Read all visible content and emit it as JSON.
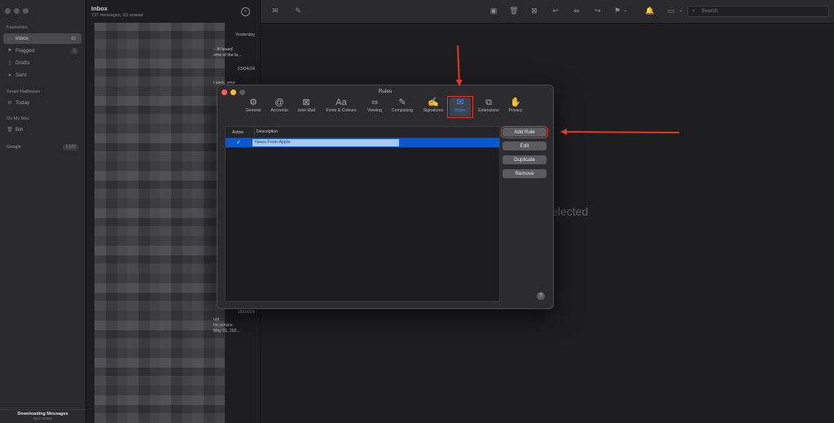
{
  "sidebar": {
    "favourites_heading": "Favourites",
    "items": [
      {
        "icon": "inbox-icon",
        "label": "Inbox",
        "badge": "63"
      },
      {
        "icon": "flag-icon",
        "label": "Flagged",
        "badge": "1"
      },
      {
        "icon": "drafts-icon",
        "label": "Drafts"
      },
      {
        "icon": "sent-icon",
        "label": "Sent"
      }
    ],
    "smart_heading": "Smart Mailboxes",
    "smart_items": [
      {
        "icon": "gear-icon",
        "label": "Today"
      }
    ],
    "mac_heading": "On My Mac",
    "mac_items": [
      {
        "icon": "trash-icon",
        "label": "Bin"
      }
    ],
    "google_label": "Google",
    "google_badge": "1,022",
    "status_title": "Downloading Messages",
    "status_sub": "54.2 of 644"
  },
  "message_list": {
    "title": "Inbox",
    "subtitle": "737 messages, 63 unread",
    "dates": [
      "Yesterday",
      "23/04/24",
      "18/04/24"
    ],
    "snippet1": [
      "– AI board",
      "ome of the la..."
    ],
    "snippet2": [
      "t pack, your"
    ],
    "snippet3": [
      "unt",
      "he service",
      "May 01, 202..."
    ]
  },
  "toolbar": {
    "search_placeholder": "Search"
  },
  "content": {
    "empty_text": "e Selected"
  },
  "dialog": {
    "title": "Rules",
    "tabs": [
      {
        "icon": "gear-icon",
        "label": "General"
      },
      {
        "icon": "at-icon",
        "label": "Accounts"
      },
      {
        "icon": "junk-mail-icon",
        "label": "Junk Mail"
      },
      {
        "icon": "fonts-icon",
        "label": "Fonts & Colours"
      },
      {
        "icon": "glasses-icon",
        "label": "Viewing"
      },
      {
        "icon": "compose-icon",
        "label": "Composing"
      },
      {
        "icon": "signature-icon",
        "label": "Signatures"
      },
      {
        "icon": "rules-icon",
        "label": "Rules"
      },
      {
        "icon": "extensions-icon",
        "label": "Extensions"
      },
      {
        "icon": "hand-icon",
        "label": "Privacy"
      }
    ],
    "active_tab": "Rules",
    "table": {
      "col_active": "Active",
      "col_description": "Description",
      "rows": [
        {
          "active": true,
          "description": "News From Apple"
        }
      ]
    },
    "buttons": {
      "add_rule": "Add Rule",
      "edit": "Edit",
      "duplicate": "Duplicate",
      "remove": "Remove",
      "help": "?"
    }
  },
  "colors": {
    "accent_blue": "#0a58cf",
    "highlight_red": "#e03a24",
    "traffic_red": "#ff5f57",
    "traffic_yellow": "#febc2e",
    "traffic_gray": "#5a5a5e"
  }
}
